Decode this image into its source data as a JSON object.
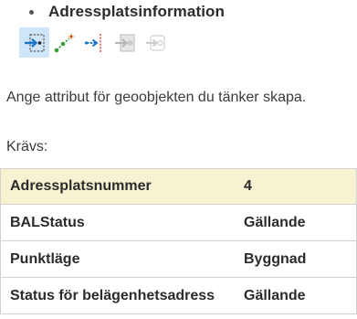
{
  "section": {
    "title": "Adressplatsinformation"
  },
  "toolbar": {
    "tools": [
      {
        "icon": "point-entry-icon",
        "state": "active"
      },
      {
        "icon": "line-sparkle-icon",
        "state": "enabled"
      },
      {
        "icon": "dimension-line-icon",
        "state": "enabled"
      },
      {
        "icon": "point-entry-disabled-icon",
        "state": "disabled"
      },
      {
        "icon": "point-entry-outline-disabled-icon",
        "state": "disabled"
      }
    ]
  },
  "instruction": "Ange attribut för geoobjekten du tänker skapa.",
  "required_label": "Krävs:",
  "attributes": [
    {
      "name": "Adressplatsnummer",
      "value": "4",
      "highlighted": true
    },
    {
      "name": "BALStatus",
      "value": "Gällande",
      "highlighted": false
    },
    {
      "name": "Punktläge",
      "value": "Byggnad",
      "highlighted": false
    },
    {
      "name": "Status för belägenhetsadress",
      "value": "Gällande",
      "highlighted": false
    }
  ],
  "colors": {
    "active_tool_bg": "#cfe6fa",
    "highlight_row_bg": "#f7f2d2",
    "accent_blue": "#1c74c6",
    "accent_green": "#3a9b3a",
    "accent_red": "#d9342b"
  }
}
